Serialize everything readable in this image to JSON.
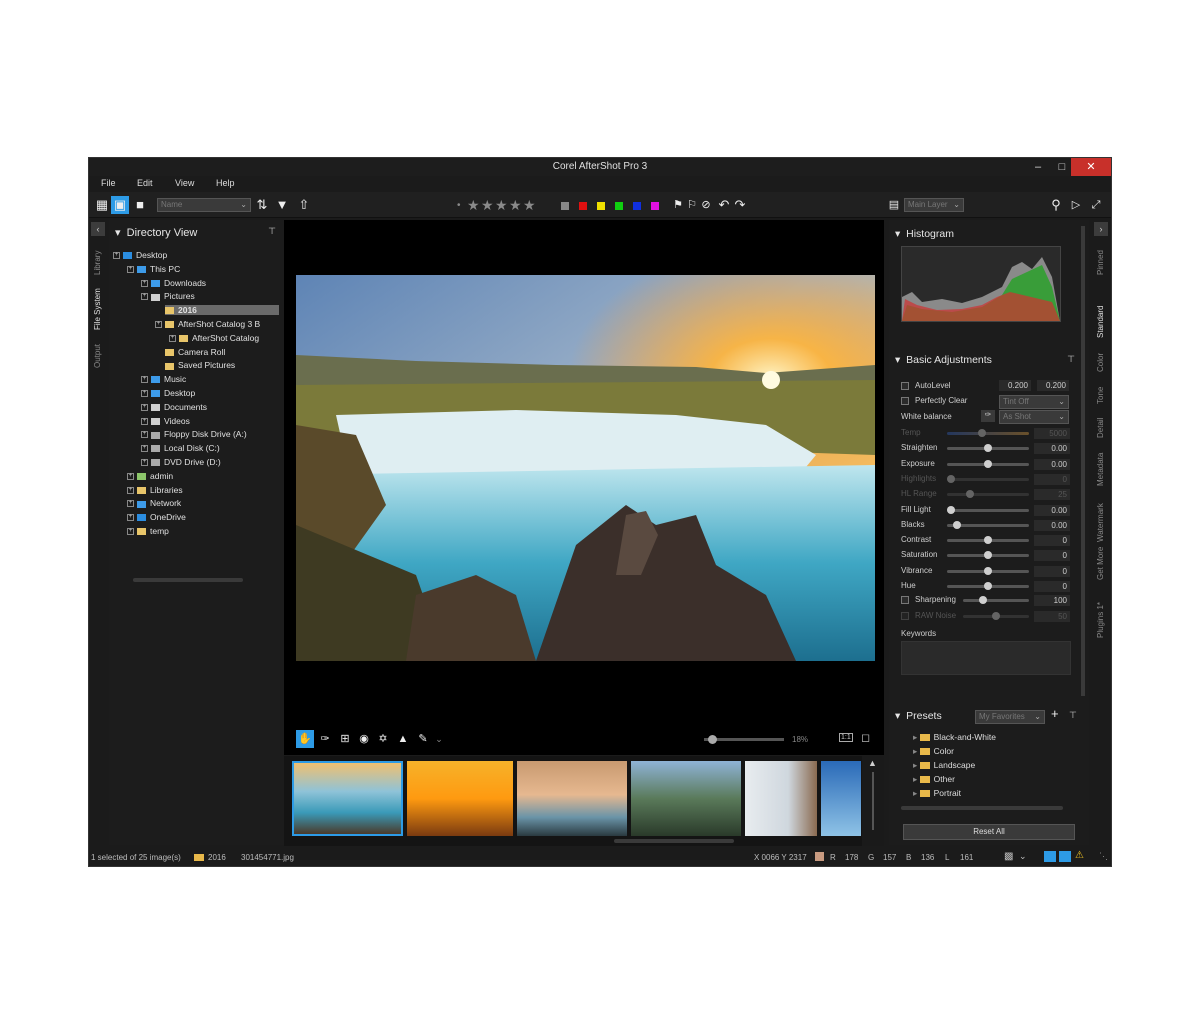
{
  "window": {
    "title": "Corel AfterShot Pro 3"
  },
  "menu": [
    {
      "label": "File"
    },
    {
      "label": "Edit"
    },
    {
      "label": "View"
    },
    {
      "label": "Help"
    }
  ],
  "toolbar": {
    "sort_value": "Name",
    "layer_value": "Main Layer"
  },
  "left_tabs": [
    "Library",
    "File System",
    "Output"
  ],
  "left_panel": {
    "title": "Directory View",
    "tree": [
      {
        "label": "Desktop",
        "icon": "desktop-icon",
        "color": "#2b8de0"
      },
      {
        "label": "This PC",
        "icon": "pc-icon",
        "color": "#3d9be9"
      },
      {
        "label": "Downloads",
        "icon": "download-icon",
        "color": "#3d9be9"
      },
      {
        "label": "Pictures",
        "icon": "pictures-icon",
        "color": "#cfcfcf"
      },
      {
        "label": "2016",
        "icon": "folder-icon",
        "color": "#e8c56a",
        "selected": true
      },
      {
        "label": "AfterShot Catalog 3 B",
        "icon": "folder-icon",
        "color": "#e8c56a"
      },
      {
        "label": "AfterShot Catalog",
        "icon": "folder-icon",
        "color": "#e8c56a"
      },
      {
        "label": "Camera Roll",
        "icon": "folder-icon",
        "color": "#e8c56a"
      },
      {
        "label": "Saved Pictures",
        "icon": "folder-icon",
        "color": "#e8c56a"
      },
      {
        "label": "Music",
        "icon": "music-icon",
        "color": "#3d9be9"
      },
      {
        "label": "Desktop",
        "icon": "desktop-icon",
        "color": "#3d9be9"
      },
      {
        "label": "Documents",
        "icon": "documents-icon",
        "color": "#cfcfcf"
      },
      {
        "label": "Videos",
        "icon": "videos-icon",
        "color": "#cfcfcf"
      },
      {
        "label": "Floppy Disk Drive (A:)",
        "icon": "floppy-icon",
        "color": "#aaaaaa"
      },
      {
        "label": "Local Disk (C:)",
        "icon": "disk-icon",
        "color": "#aaaaaa"
      },
      {
        "label": "DVD Drive (D:)",
        "icon": "dvd-icon",
        "color": "#aaaaaa"
      },
      {
        "label": "admin",
        "icon": "user-icon",
        "color": "#8cc66a"
      },
      {
        "label": "Libraries",
        "icon": "libraries-icon",
        "color": "#e8c56a"
      },
      {
        "label": "Network",
        "icon": "network-icon",
        "color": "#3d9be9"
      },
      {
        "label": "OneDrive",
        "icon": "cloud-icon",
        "color": "#2b8de0"
      },
      {
        "label": "temp",
        "icon": "folder-icon",
        "color": "#e8c56a"
      }
    ]
  },
  "viewer": {
    "zoom": "18%",
    "ratio_label": "1:1"
  },
  "histogram": {
    "title": "Histogram"
  },
  "basic_adjustments": {
    "title": "Basic Adjustments",
    "autolevel": {
      "label": "AutoLevel",
      "v1": "0.200",
      "v2": "0.200"
    },
    "perfectly_clear": {
      "label": "Perfectly Clear",
      "value": "Tint Off"
    },
    "white_balance": {
      "label": "White balance",
      "value": "As Shot"
    },
    "sliders": [
      {
        "label": "Temp",
        "value": "5000",
        "pos": 0.42,
        "dim": true
      },
      {
        "label": "Straighten",
        "value": "0.00",
        "pos": 0.5
      },
      {
        "label": "Exposure",
        "value": "0.00",
        "pos": 0.5
      },
      {
        "label": "Highlights",
        "value": "0",
        "pos": 0.0,
        "dim": true
      },
      {
        "label": "HL Range",
        "value": "25",
        "pos": 0.25,
        "dim": true
      },
      {
        "label": "Fill Light",
        "value": "0.00",
        "pos": 0.0
      },
      {
        "label": "Blacks",
        "value": "0.00",
        "pos": 0.08
      },
      {
        "label": "Contrast",
        "value": "0",
        "pos": 0.5
      },
      {
        "label": "Saturation",
        "value": "0",
        "pos": 0.5
      },
      {
        "label": "Vibrance",
        "value": "0",
        "pos": 0.5
      },
      {
        "label": "Hue",
        "value": "0",
        "pos": 0.5
      }
    ],
    "sharpening": {
      "label": "Sharpening",
      "value": "100",
      "pos": 0.28
    },
    "raw_noise": {
      "label": "RAW Noise",
      "value": "50",
      "pos": 0.5
    },
    "keywords_label": "Keywords"
  },
  "presets": {
    "title": "Presets",
    "selector": "My Favorites",
    "items": [
      "Black-and-White",
      "Color",
      "Landscape",
      "Other",
      "Portrait"
    ],
    "reset_label": "Reset All"
  },
  "right_tabs": [
    "Pinned",
    "Standard",
    "Color",
    "Tone",
    "Detail",
    "Metadata",
    "Watermark",
    "Get More",
    "Plugins 1*"
  ],
  "status": {
    "selection": "1 selected of 25 image(s)",
    "folder": "2016",
    "file": "301454771.jpg",
    "coords": "X 0066  Y 2317",
    "r_label": "R",
    "r": "178",
    "g_label": "G",
    "g": "157",
    "b_label": "B",
    "b": "136",
    "l_label": "L",
    "l": "161"
  }
}
